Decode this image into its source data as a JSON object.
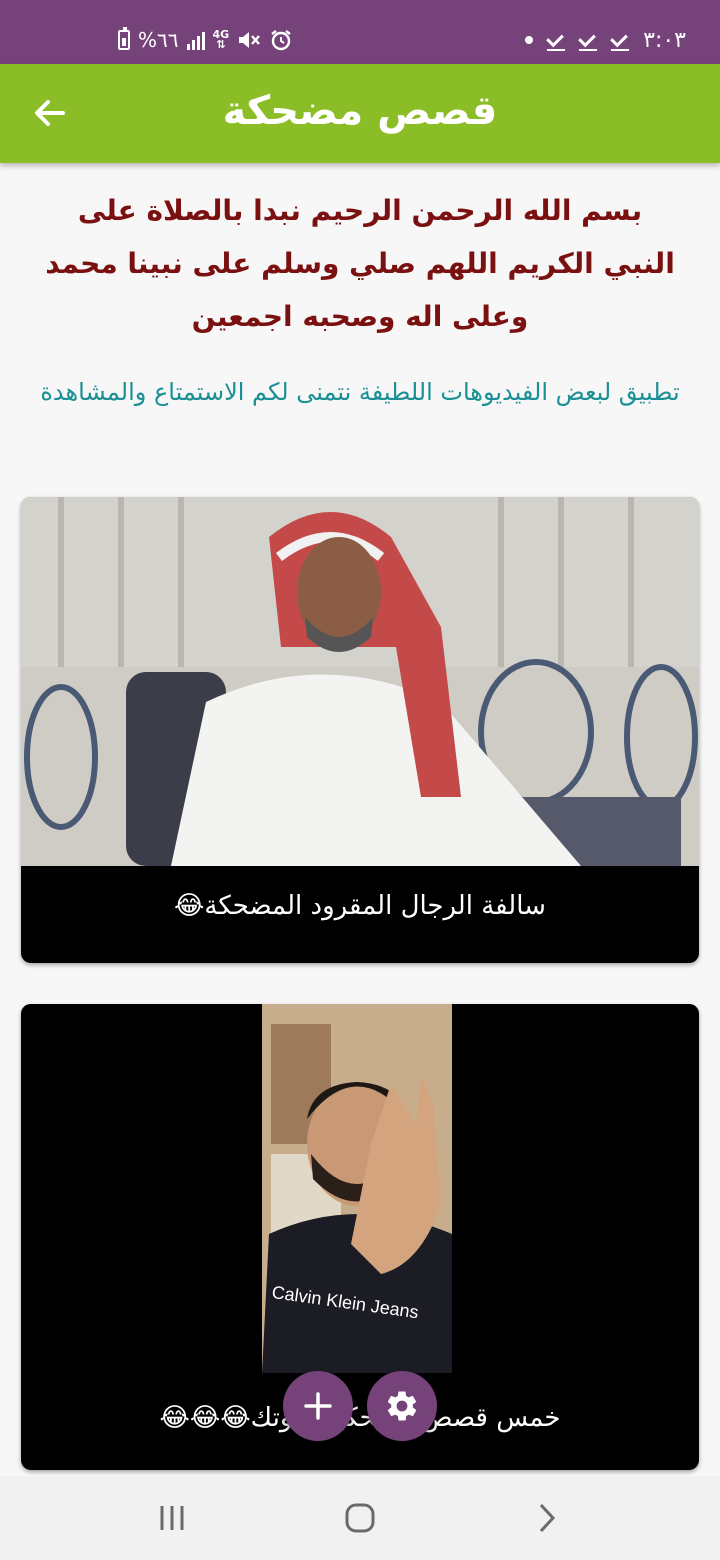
{
  "status_bar": {
    "time": "٣:٠٣",
    "battery_text": "%٦٦",
    "network": "4G",
    "icons": [
      "dot-icon",
      "check-icon",
      "check-icon",
      "check-icon",
      "alarm-icon",
      "mute-icon",
      "network-4g-icon",
      "signal-icon",
      "battery-icon"
    ]
  },
  "app_bar": {
    "title": "قصص مضحكة",
    "back_icon": "arrow-left-icon"
  },
  "intro": {
    "basmala": "بسم الله الرحمن الرحيم نبدا بالصلاة على النبي الكريم اللهم صلي وسلم على نبينا محمد وعلى اله وصحبه اجمعين",
    "description": "تطبيق لبعض الفيديوهات اللطيفة نتمنى لكم الاستمتاع والمشاهدة"
  },
  "videos": [
    {
      "title": "سالفة الرجال المقرود المضحكة😂"
    },
    {
      "title": "خمس قصص مضحكة بصوتك😂😂😂"
    }
  ],
  "fabs": {
    "add_icon": "plus-icon",
    "settings_icon": "gear-icon"
  },
  "nav_bar": {
    "items": [
      "recents-icon",
      "home-icon",
      "back-icon"
    ]
  },
  "colors": {
    "status_bar": "#76427a",
    "app_bar": "#8bbd26",
    "basmala_text": "#7a1010",
    "description_text": "#1a8f95",
    "fab": "#76427a"
  }
}
